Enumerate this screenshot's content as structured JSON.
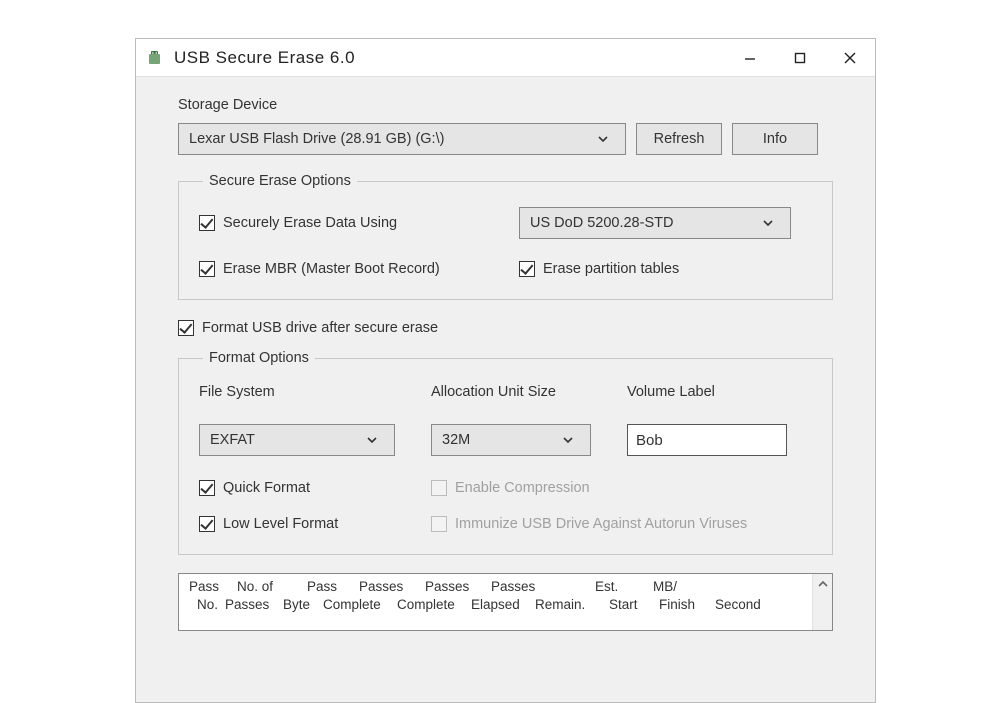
{
  "window": {
    "title": "USB Secure Erase 6.0"
  },
  "labels": {
    "storage_device": "Storage Device",
    "file_system": "File System",
    "allocation": "Allocation Unit Size",
    "volume_label": "Volume Label"
  },
  "device_select": "Lexar USB Flash Drive (28.91 GB) (G:\\)",
  "buttons": {
    "refresh": "Refresh",
    "info": "Info"
  },
  "groups": {
    "secure": "Secure Erase Options",
    "format": "Format Options"
  },
  "checks": {
    "securely_erase": "Securely Erase Data Using",
    "erase_mbr": "Erase MBR (Master Boot Record)",
    "erase_pt": "Erase partition tables",
    "format_after": "Format USB drive after secure erase",
    "quick_format": "Quick Format",
    "enable_compression": "Enable Compression",
    "low_level": "Low Level Format",
    "immunize": "Immunize USB Drive Against Autorun Viruses"
  },
  "selects": {
    "erase_method": "US DoD 5200.28-STD",
    "file_system": "EXFAT",
    "allocation": "32M"
  },
  "inputs": {
    "volume_label": "Bob"
  },
  "log_header": {
    "l1_c1": "Pass",
    "l1_c2": "No. of",
    "l1_c3": "Pass",
    "l1_c4": "Passes",
    "l1_c5": "Passes",
    "l1_c6": "Passes",
    "l1_c7": "Est.",
    "l1_c8": "MB/",
    "l2_c1": "No.",
    "l2_c2": "Passes",
    "l2_c3": "Byte",
    "l2_c4": "Complete",
    "l2_c5": "Complete",
    "l2_c6": "Elapsed",
    "l2_c7": "Remain.",
    "l2_c8": "Start",
    "l2_c9": "Finish",
    "l2_c10": "Second"
  }
}
